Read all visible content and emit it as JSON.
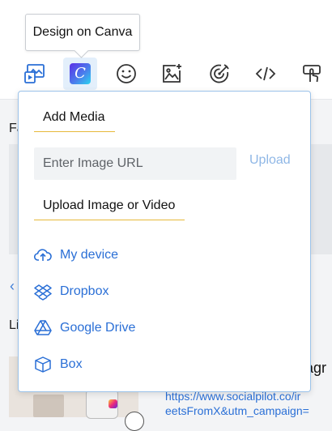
{
  "tooltip": {
    "text": "Design on Canva"
  },
  "toolbar": {
    "canva_letter": "C",
    "icons": [
      "media-icon",
      "canva-icon",
      "emoji-icon",
      "image-icon",
      "target-icon",
      "code-icon",
      "hand-pointer-icon"
    ]
  },
  "background": {
    "label_fa": "Fa",
    "label_li": "Li",
    "chevron": "‹",
    "title_fragment": "tagr",
    "link_line1": "https://www.socialpilot.co/ir",
    "link_line2": "eetsFromX&utm_campaign="
  },
  "panel": {
    "add_media_title": "Add Media",
    "image_url": {
      "placeholder": "Enter Image URL",
      "value": ""
    },
    "upload_label": "Upload",
    "upload_section_title": "Upload Image or Video",
    "sources": [
      {
        "label": "My device",
        "icon": "cloud-upload-icon"
      },
      {
        "label": "Dropbox",
        "icon": "dropbox-icon"
      },
      {
        "label": "Google Drive",
        "icon": "google-drive-icon"
      },
      {
        "label": "Box",
        "icon": "box-icon"
      }
    ]
  },
  "colors": {
    "accent_link": "#2a6fd6",
    "underline": "#e7b93a",
    "panel_border": "#9cc3ea",
    "upload_disabled": "#8fb7e6"
  }
}
